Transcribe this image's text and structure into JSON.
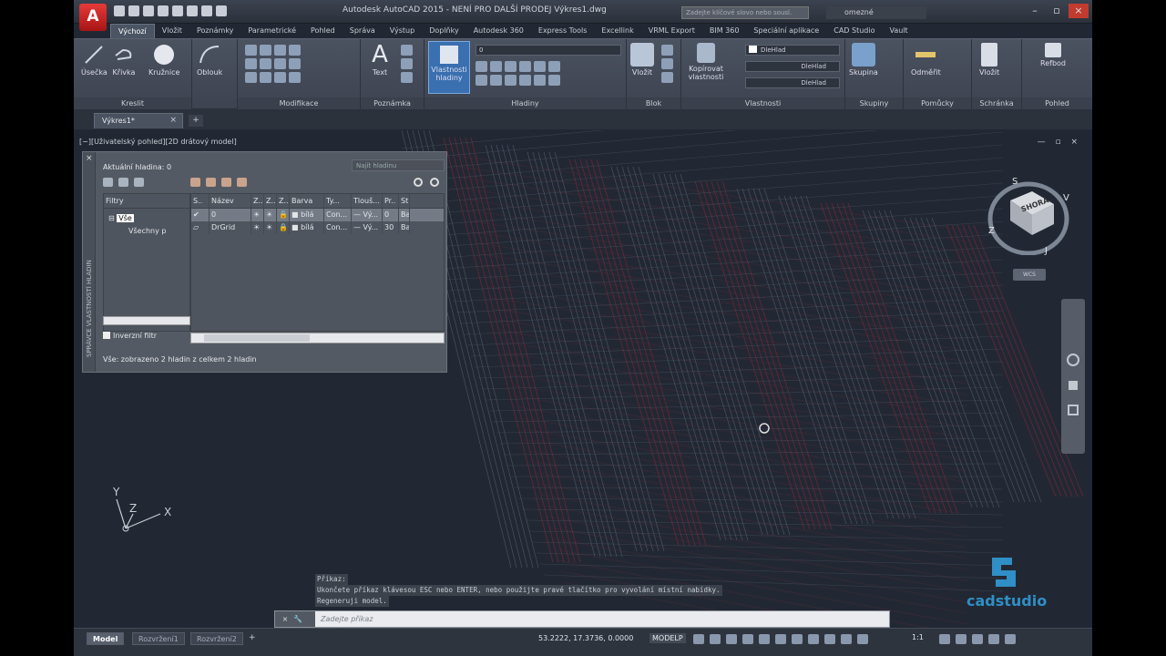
{
  "app": {
    "logo_letter": "A",
    "title": "Autodesk AutoCAD 2015 - NENÍ PRO DALŠÍ PRODEJ   Výkres1.dwg",
    "search_placeholder": "Zadejte klíčové slovo nebo sousl.",
    "user": "omezné"
  },
  "tabs": [
    "Výchozí",
    "Vložit",
    "Poznámky",
    "Parametrické",
    "Pohled",
    "Správa",
    "Výstup",
    "Doplňky",
    "Autodesk 360",
    "Express Tools",
    "Excellink",
    "VRML Export",
    "BIM 360",
    "Speciální aplikace",
    "CAD Studio",
    "Vault"
  ],
  "ribbon": {
    "draw": {
      "label": "Kreslit",
      "tools": [
        "Úsečka",
        "Křivka",
        "Kružnice",
        "Oblouk"
      ]
    },
    "modify": {
      "label": "Modifikace"
    },
    "annotation": {
      "label": "Poznámka",
      "text_tool": "Text"
    },
    "layers": {
      "label": "Hladiny",
      "props_button": "Vlastnosti hladiny",
      "current_layer": "0"
    },
    "block": {
      "label": "Blok",
      "insert": "Vložit"
    },
    "properties": {
      "label": "Vlastnosti",
      "copy": "Kopírovat vlastnosti",
      "color": "DleHlad",
      "linetype": "DleHlad",
      "lineweight": "DleHlad"
    },
    "groups": {
      "label": "Skupiny",
      "group": "Skupina"
    },
    "utilities": {
      "label": "Pomůcky",
      "measure": "Odměřit"
    },
    "clipboard": {
      "label": "Schránka",
      "paste": "Vložit"
    },
    "view": {
      "label": "Pohled",
      "base": "Refbod"
    }
  },
  "document": {
    "tab": "Výkres1*",
    "plus": "+"
  },
  "viewport": {
    "label": "[−][Uživatelský pohled][2D drátový model]"
  },
  "layer_manager": {
    "side_title": "SPRÁVCE VLASTNOSTÍ HLADIN",
    "current": "Aktuální hladina: 0",
    "search": "Najít hladinu",
    "filters_header": "Filtry",
    "tree": [
      "Vše",
      "Všechny p"
    ],
    "invert": "Inverzní filtr",
    "columns": [
      "S..",
      "Název",
      "Z..",
      "Z..",
      "Z..",
      "Barva",
      "Ty...",
      "Tlouš...",
      "Pr..",
      "St"
    ],
    "rows": [
      [
        "✔",
        "0",
        "☀",
        "☀",
        "🔒",
        "■ bílá",
        "Con...",
        "— Vý...",
        "0",
        "Ba"
      ],
      [
        "▱",
        "DrGrid",
        "☀",
        "☀",
        "🔒",
        "■ bílá",
        "Con...",
        "— Vý...",
        "30",
        "Ba"
      ]
    ],
    "status": "Vše: zobrazeno 2 hladin z celkem 2 hladin"
  },
  "viewcube": {
    "face": "SHORA",
    "n": "S",
    "e": "V",
    "s": "J",
    "w": "Z",
    "wcs": "WCS"
  },
  "ucs": {
    "x": "X",
    "y": "Y",
    "z": "Z"
  },
  "command": {
    "history": [
      "Příkaz:",
      "Ukončete příkaz klávesou ESC nebo ENTER, nebo použijte pravé tlačítko pro vyvolání místní nabídky.",
      "Regeneruji model."
    ],
    "prompt": "Zadejte příkaz"
  },
  "brand": "cadstudio",
  "status": {
    "layouts": [
      "Model",
      "Rozvržení1",
      "Rozvržení2"
    ],
    "coords": "53.2222, 17.3736, 0.0000",
    "space": "MODELP",
    "scale": "1:1"
  }
}
